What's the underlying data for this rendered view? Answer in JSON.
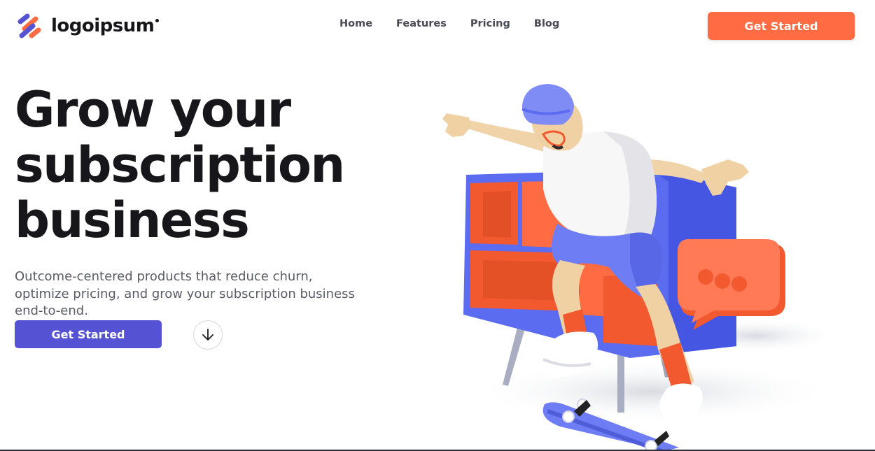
{
  "header": {
    "logo_text": "logoipsum",
    "nav": [
      {
        "label": "Home"
      },
      {
        "label": "Features"
      },
      {
        "label": "Pricing"
      },
      {
        "label": "Blog"
      }
    ],
    "cta_label": "Get Started"
  },
  "hero": {
    "title_lines": [
      "Grow your",
      "subscription",
      "business"
    ],
    "subtitle_lines": [
      "Outcome-centered products that reduce churn,",
      "optimize pricing, and grow your subscription business",
      "end-to-end."
    ],
    "cta_label": "Get Started"
  },
  "icons": {
    "logo": "logo-mark-icon",
    "scroll": "arrow-down-icon"
  },
  "colors": {
    "accent_orange": "#ff6b42",
    "primary_purple": "#5553d3",
    "heading": "#17171b",
    "body_text": "#5b5b66",
    "nav_text": "#4a4a55",
    "illustration_blue": "#5b6cf0",
    "illustration_orange": "#f2592e"
  }
}
